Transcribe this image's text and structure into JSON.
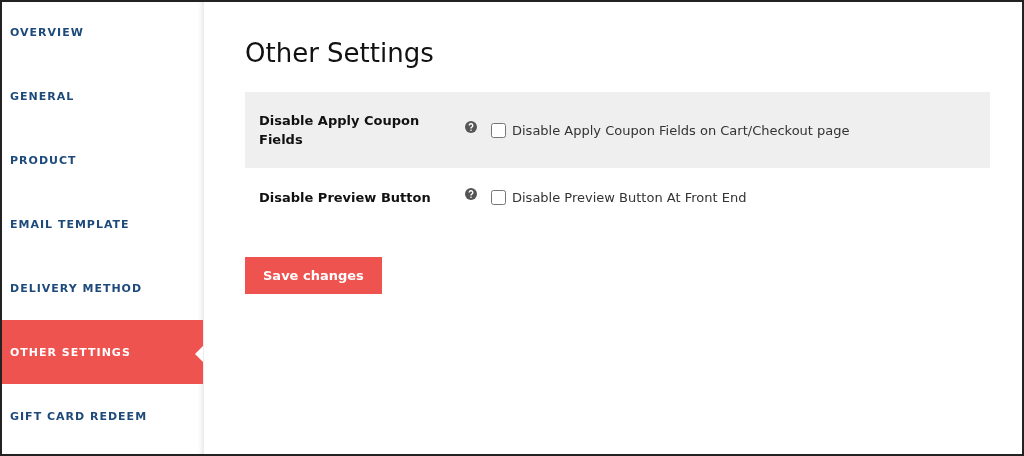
{
  "sidebar": {
    "items": [
      {
        "label": "OVERVIEW",
        "selected": false
      },
      {
        "label": "GENERAL",
        "selected": false
      },
      {
        "label": "PRODUCT",
        "selected": false
      },
      {
        "label": "EMAIL TEMPLATE",
        "selected": false
      },
      {
        "label": "DELIVERY METHOD",
        "selected": false
      },
      {
        "label": "OTHER SETTINGS",
        "selected": true
      },
      {
        "label": "GIFT CARD REDEEM",
        "selected": false
      }
    ]
  },
  "page": {
    "title": "Other Settings",
    "settings": [
      {
        "label": "Disable Apply Coupon Fields",
        "option": "Disable Apply Coupon Fields on Cart/Checkout page",
        "checked": false,
        "shaded": true
      },
      {
        "label": "Disable Preview Button",
        "option": "Disable Preview Button At Front End",
        "checked": false,
        "shaded": false
      }
    ],
    "save_button": "Save changes"
  }
}
